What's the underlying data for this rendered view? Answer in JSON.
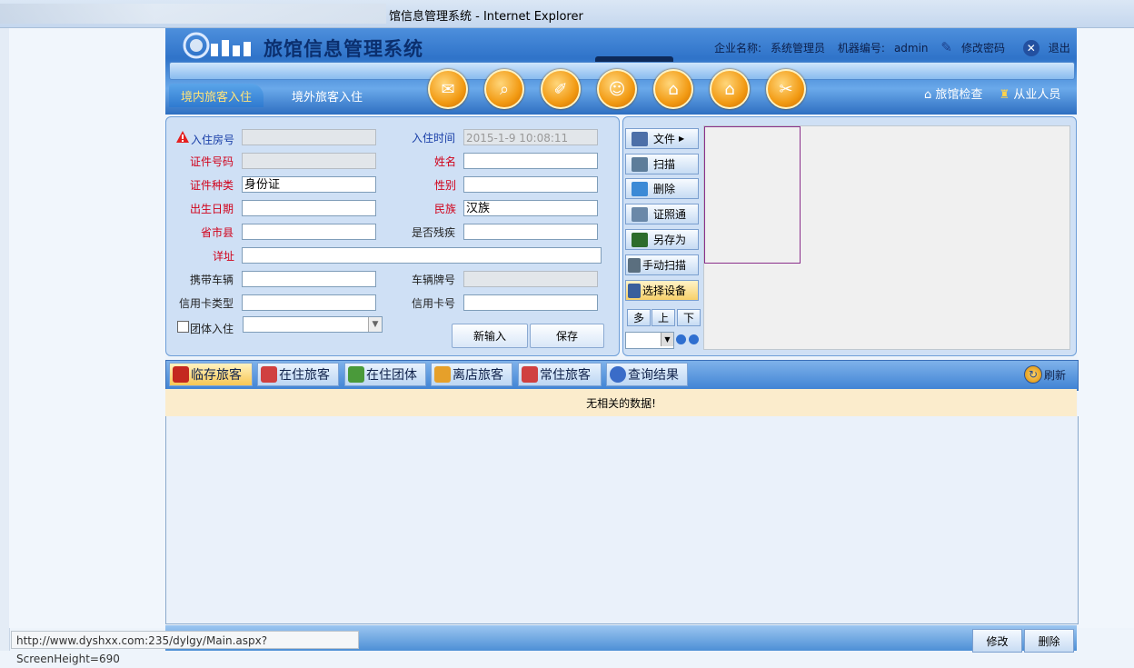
{
  "window": {
    "title": "馆信息管理系统 - Internet Explorer"
  },
  "header": {
    "system_name": "旅馆信息管理系统",
    "company_label": "企业名称:",
    "company_value": "系统管理员",
    "machine_label": "机器编号:",
    "machine_value": "admin",
    "change_password": "修改密码",
    "logout": "退出"
  },
  "nav": {
    "tab_domestic": "境内旅客入住",
    "tab_foreign": "境外旅客入住",
    "hotel_check": "旅馆检查",
    "staff": "从业人员",
    "toolbar_icons": [
      "mail-icon",
      "search-icon",
      "clean-icon",
      "user-icon",
      "home-settings-icon",
      "home-search-icon",
      "tools-icon"
    ]
  },
  "form": {
    "room_label": "入住房号",
    "room_value": "",
    "checkin_time_label": "入住时间",
    "checkin_time_value": "2015-1-9 10:08:11",
    "id_number_label": "证件号码",
    "id_number_value": "",
    "name_label": "姓名",
    "name_value": "",
    "id_type_label": "证件种类",
    "id_type_value": "身份证",
    "gender_label": "性别",
    "gender_value": "",
    "birth_label": "出生日期",
    "birth_value": "",
    "ethnicity_label": "民族",
    "ethnicity_value": "汉族",
    "region_label": "省市县",
    "region_value": "",
    "disabled_label": "是否残疾",
    "disabled_value": "",
    "address_label": "详址",
    "address_value": "",
    "vehicle_label": "携带车辆",
    "vehicle_value": "",
    "plate_label": "车辆牌号",
    "plate_value": "",
    "card_type_label": "信用卡类型",
    "card_type_value": "",
    "card_no_label": "信用卡号",
    "card_no_value": "",
    "group_label": "团体入住",
    "group_value": "",
    "new_button": "新输入",
    "save_button": "保存"
  },
  "scanner": {
    "file": "文件",
    "scan": "扫描",
    "delete": "删除",
    "id_photo": "证照通",
    "save_as": "另存为",
    "manual_scan": "手动扫描",
    "select_device": "选择设备",
    "multi": "多",
    "up": "上",
    "down": "下",
    "device_select_value": ""
  },
  "list": {
    "tabs": [
      "临存旅客",
      "在住旅客",
      "在住团体",
      "离店旅客",
      "常住旅客",
      "查询结果"
    ],
    "refresh": "刷新",
    "no_data": "无相关的数据!"
  },
  "bottom": {
    "status_url": "http://www.dyshxx.com:235/dylgy/Main.aspx?ScreenHeight=690",
    "edit": "修改",
    "delete": "删除"
  },
  "colors": {
    "header_blue": "#2f73c9",
    "required_red": "#d0021b",
    "label_blue": "#1a3fa8",
    "active_tab": "#f7c754"
  }
}
